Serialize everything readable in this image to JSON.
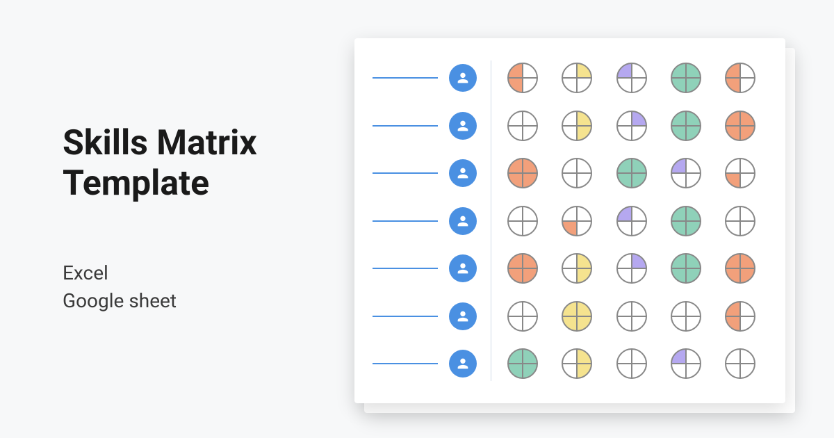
{
  "title_line1": "Skills Matrix",
  "title_line2": "Template",
  "subtitle_line1": "Excel",
  "subtitle_line2": "Google sheet",
  "colors": {
    "orange": "#f2a07b",
    "yellow": "#f5e38f",
    "purple": "#b5a8f0",
    "teal": "#8fd1b9",
    "stroke": "#888888",
    "blank": "#ffffff"
  },
  "matrix": [
    [
      [
        "orange",
        "blank",
        "blank",
        "orange"
      ],
      [
        "blank",
        "yellow",
        "blank",
        "blank"
      ],
      [
        "purple",
        "blank",
        "blank",
        "blank"
      ],
      [
        "teal",
        "teal",
        "teal",
        "teal"
      ],
      [
        "orange",
        "blank",
        "blank",
        "orange"
      ]
    ],
    [
      [
        "blank",
        "blank",
        "blank",
        "blank"
      ],
      [
        "blank",
        "yellow",
        "yellow",
        "blank"
      ],
      [
        "blank",
        "purple",
        "blank",
        "blank"
      ],
      [
        "teal",
        "teal",
        "teal",
        "teal"
      ],
      [
        "orange",
        "orange",
        "orange",
        "orange"
      ]
    ],
    [
      [
        "orange",
        "orange",
        "orange",
        "orange"
      ],
      [
        "blank",
        "blank",
        "blank",
        "blank"
      ],
      [
        "teal",
        "teal",
        "teal",
        "teal"
      ],
      [
        "purple",
        "blank",
        "blank",
        "blank"
      ],
      [
        "blank",
        "blank",
        "blank",
        "orange"
      ]
    ],
    [
      [
        "blank",
        "blank",
        "blank",
        "blank"
      ],
      [
        "blank",
        "blank",
        "blank",
        "orange"
      ],
      [
        "purple",
        "blank",
        "blank",
        "blank"
      ],
      [
        "teal",
        "teal",
        "teal",
        "teal"
      ],
      [
        "blank",
        "blank",
        "blank",
        "blank"
      ]
    ],
    [
      [
        "orange",
        "orange",
        "orange",
        "orange"
      ],
      [
        "blank",
        "yellow",
        "yellow",
        "blank"
      ],
      [
        "blank",
        "purple",
        "blank",
        "blank"
      ],
      [
        "teal",
        "teal",
        "teal",
        "teal"
      ],
      [
        "orange",
        "orange",
        "orange",
        "orange"
      ]
    ],
    [
      [
        "blank",
        "blank",
        "blank",
        "blank"
      ],
      [
        "yellow",
        "yellow",
        "yellow",
        "yellow"
      ],
      [
        "blank",
        "blank",
        "blank",
        "blank"
      ],
      [
        "blank",
        "blank",
        "blank",
        "blank"
      ],
      [
        "orange",
        "blank",
        "blank",
        "orange"
      ]
    ],
    [
      [
        "teal",
        "teal",
        "teal",
        "teal"
      ],
      [
        "blank",
        "yellow",
        "yellow",
        "blank"
      ],
      [
        "blank",
        "blank",
        "blank",
        "blank"
      ],
      [
        "purple",
        "blank",
        "blank",
        "blank"
      ],
      [
        "blank",
        "blank",
        "blank",
        "blank"
      ]
    ]
  ]
}
